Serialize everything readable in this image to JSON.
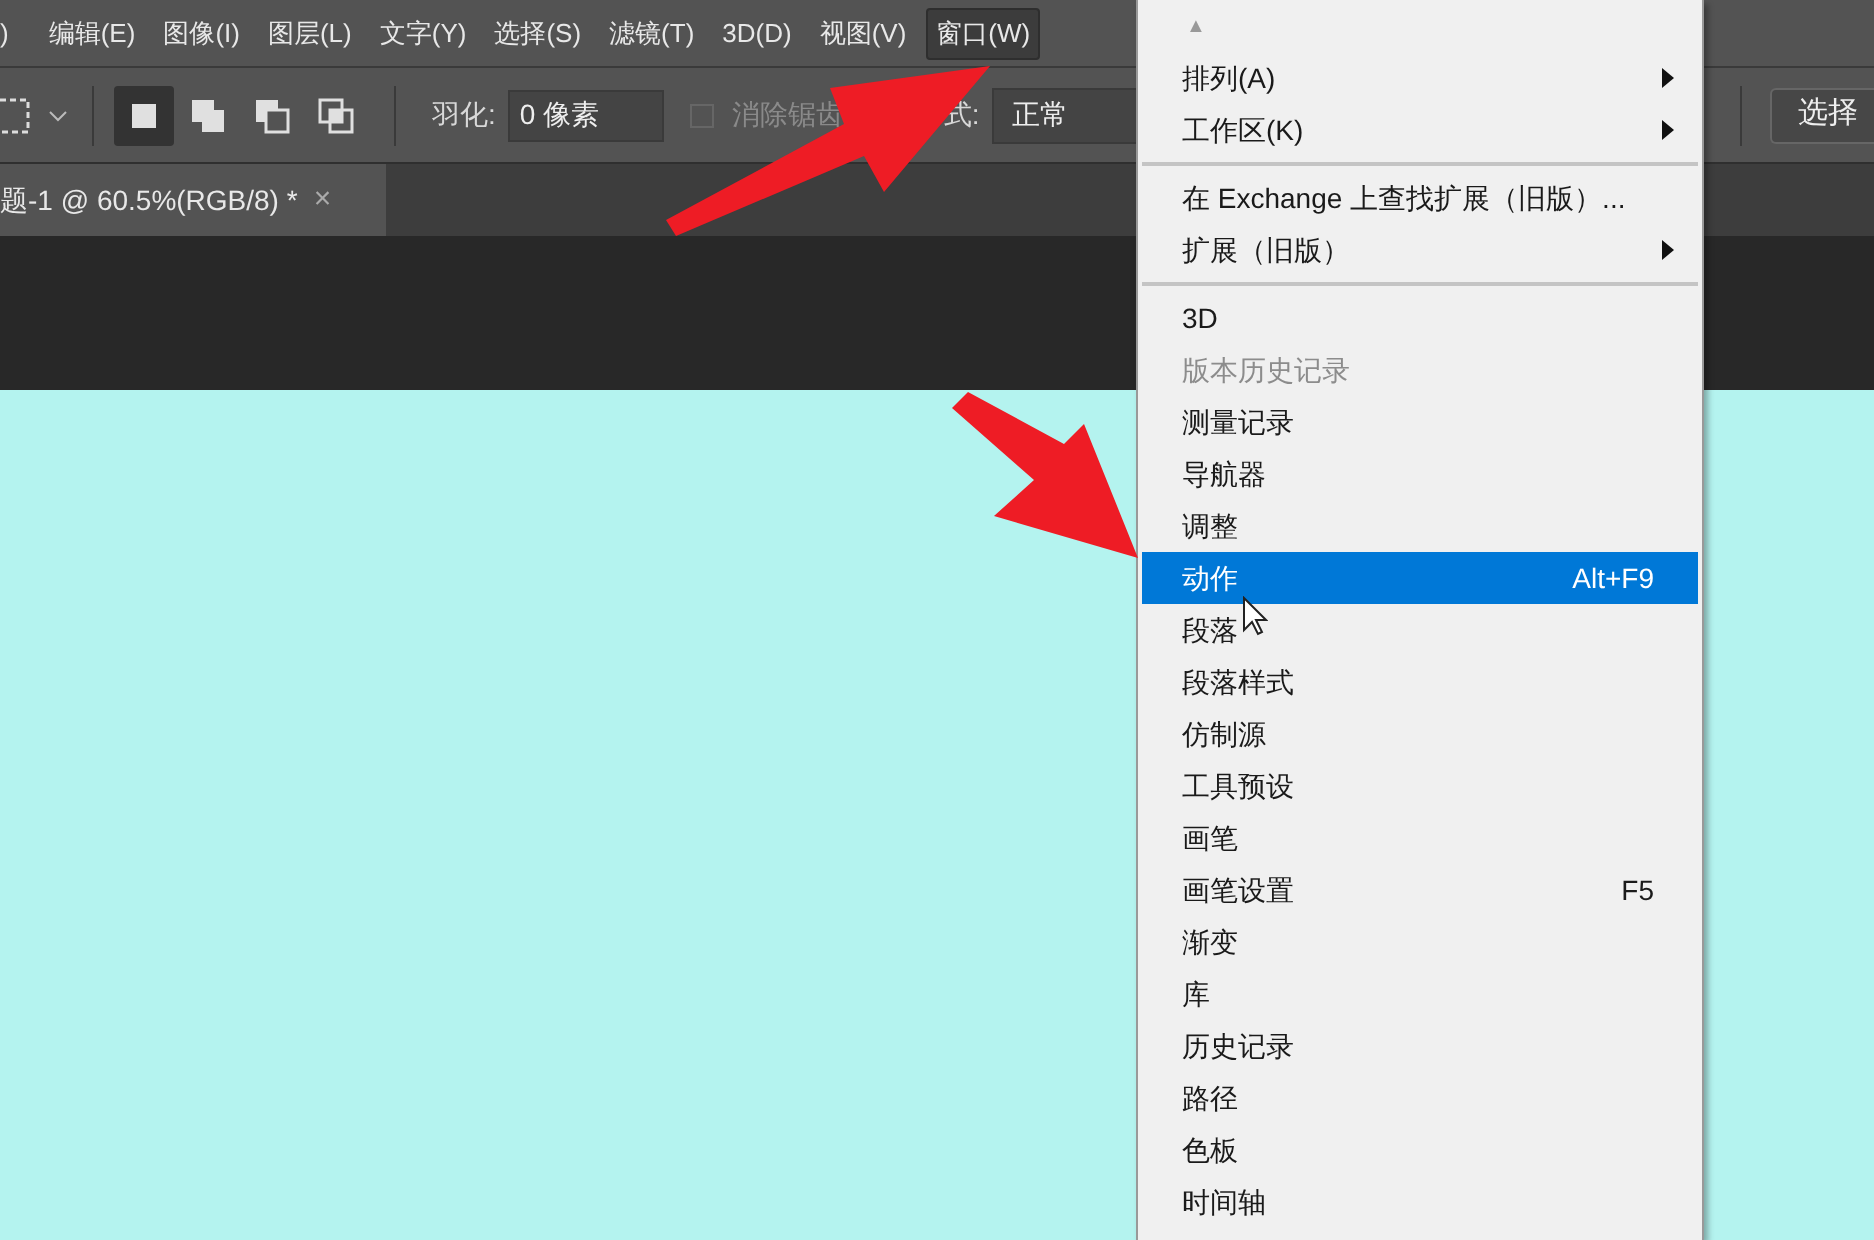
{
  "menu_bar": [
    {
      "label": ")",
      "selected": false
    },
    {
      "label": "编辑(E)",
      "selected": false
    },
    {
      "label": "图像(I)",
      "selected": false
    },
    {
      "label": "图层(L)",
      "selected": false
    },
    {
      "label": "文字(Y)",
      "selected": false
    },
    {
      "label": "选择(S)",
      "selected": false
    },
    {
      "label": "滤镜(T)",
      "selected": false
    },
    {
      "label": "3D(D)",
      "selected": false
    },
    {
      "label": "视图(V)",
      "selected": false
    },
    {
      "label": "窗口(W)",
      "selected": true
    }
  ],
  "options_bar": {
    "modes": [
      {
        "selected": true
      },
      {
        "selected": false
      },
      {
        "selected": false
      },
      {
        "selected": false
      }
    ],
    "feather_label": "羽化:",
    "feather_value": "0 像素",
    "antialias": {
      "label": "消除锯齿",
      "checked": false,
      "disabled": true
    },
    "style_label": "式:",
    "style_value": "正常",
    "right_button": "选择"
  },
  "document_tab": {
    "title": "题-1 @ 60.5%(RGB/8) *",
    "close": "×"
  },
  "window_menu": {
    "scroll_up": "▲",
    "items": [
      {
        "kind": "item",
        "label": "排列(A)",
        "submenu": true,
        "disabled": false,
        "selected": false
      },
      {
        "kind": "item",
        "label": "工作区(K)",
        "submenu": true,
        "disabled": false,
        "selected": false
      },
      {
        "kind": "separator"
      },
      {
        "kind": "item",
        "label": "在 Exchange 上查找扩展（旧版）...",
        "submenu": false,
        "disabled": false,
        "selected": false
      },
      {
        "kind": "item",
        "label": "扩展（旧版）",
        "submenu": true,
        "disabled": false,
        "selected": false
      },
      {
        "kind": "separator"
      },
      {
        "kind": "item",
        "label": "3D",
        "submenu": false,
        "disabled": false,
        "selected": false
      },
      {
        "kind": "item",
        "label": "版本历史记录",
        "submenu": false,
        "disabled": true,
        "selected": false
      },
      {
        "kind": "item",
        "label": "测量记录",
        "submenu": false,
        "disabled": false,
        "selected": false
      },
      {
        "kind": "item",
        "label": "导航器",
        "submenu": false,
        "disabled": false,
        "selected": false
      },
      {
        "kind": "item",
        "label": "调整",
        "submenu": false,
        "disabled": false,
        "selected": false
      },
      {
        "kind": "item",
        "label": "动作",
        "shortcut": "Alt+F9",
        "submenu": false,
        "disabled": false,
        "selected": true
      },
      {
        "kind": "item",
        "label": "段落",
        "submenu": false,
        "disabled": false,
        "selected": false
      },
      {
        "kind": "item",
        "label": "段落样式",
        "submenu": false,
        "disabled": false,
        "selected": false
      },
      {
        "kind": "item",
        "label": "仿制源",
        "submenu": false,
        "disabled": false,
        "selected": false
      },
      {
        "kind": "item",
        "label": "工具预设",
        "submenu": false,
        "disabled": false,
        "selected": false
      },
      {
        "kind": "item",
        "label": "画笔",
        "submenu": false,
        "disabled": false,
        "selected": false
      },
      {
        "kind": "item",
        "label": "画笔设置",
        "shortcut": "F5",
        "submenu": false,
        "disabled": false,
        "selected": false
      },
      {
        "kind": "item",
        "label": "渐变",
        "submenu": false,
        "disabled": false,
        "selected": false
      },
      {
        "kind": "item",
        "label": "库",
        "submenu": false,
        "disabled": false,
        "selected": false
      },
      {
        "kind": "item",
        "label": "历史记录",
        "submenu": false,
        "disabled": false,
        "selected": false
      },
      {
        "kind": "item",
        "label": "路径",
        "submenu": false,
        "disabled": false,
        "selected": false
      },
      {
        "kind": "item",
        "label": "色板",
        "submenu": false,
        "disabled": false,
        "selected": false
      },
      {
        "kind": "item",
        "label": "时间轴",
        "submenu": false,
        "disabled": false,
        "selected": false
      }
    ]
  }
}
